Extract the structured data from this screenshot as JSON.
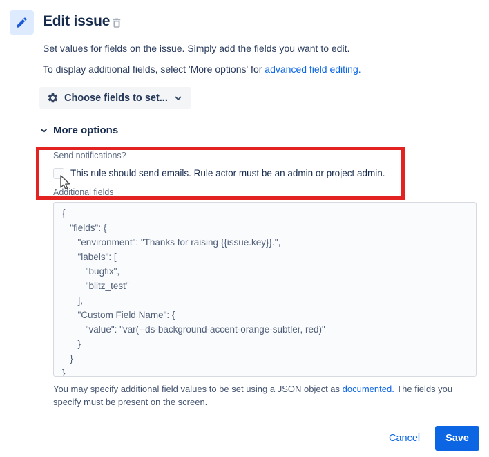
{
  "header": {
    "title": "Edit issue"
  },
  "intro": {
    "line1": "Set values for fields on the issue. Simply add the fields you want to edit.",
    "line2_prefix": "To display additional fields, select 'More options' for ",
    "line2_link": "advanced field editing."
  },
  "fields_button": {
    "label": "Choose fields to set..."
  },
  "more_options": {
    "label": "More options"
  },
  "notifications": {
    "label": "Send notifications?",
    "checkbox_label": "This rule should send emails. Rule actor must be an admin or project admin.",
    "checked": false
  },
  "additional_fields": {
    "label": "Additional fields",
    "json_value": "{\n   \"fields\": {\n      \"environment\": \"Thanks for raising {{issue.key}}.\",\n      \"labels\": [\n         \"bugfix\",\n         \"blitz_test\"\n      ],\n      \"Custom Field Name\": {\n         \"value\": \"var(--ds-background-accent-orange-subtler, red)\"\n      }\n   }\n}",
    "help_prefix": "You may specify additional field values to be set using a JSON object as ",
    "help_link": "documented.",
    "help_suffix": " The fields you specify must be present on the screen."
  },
  "footer": {
    "cancel_label": "Cancel",
    "save_label": "Save"
  },
  "colors": {
    "accent_blue": "#0C66E4",
    "title_navy": "#172B4D",
    "annotation_red": "#E32322",
    "icon_tile_bg": "#DEEBFF",
    "icon_pencil": "#1D5BD8",
    "field_bg": "#FAFBFC"
  },
  "icons": [
    "pencil-icon",
    "trash-icon",
    "gear-icon",
    "chevron-down-icon",
    "mouse-cursor"
  ]
}
